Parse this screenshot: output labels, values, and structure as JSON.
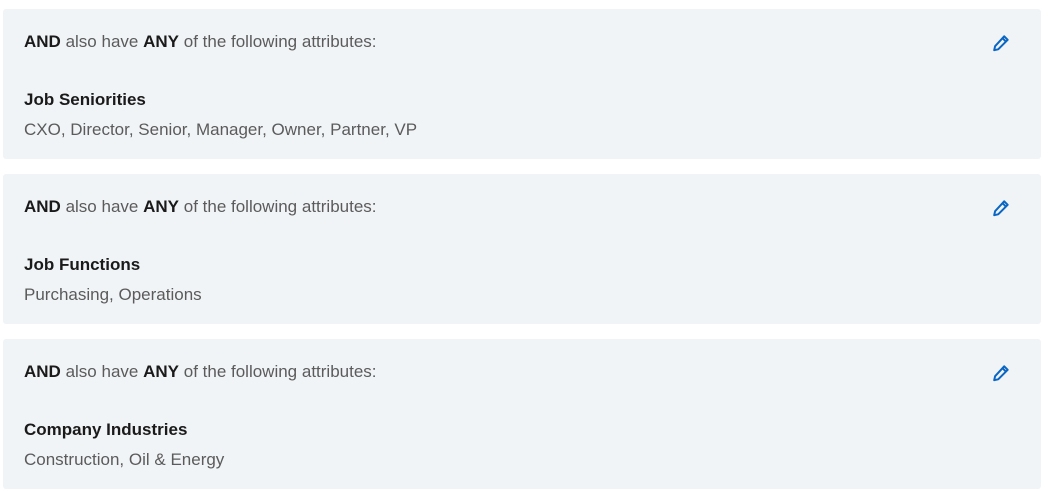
{
  "criteria": [
    {
      "and_word": "AND",
      "also_have": "also have",
      "any_word": "ANY",
      "following": "of the following attributes:",
      "attribute_name": "Job Seniorities",
      "attribute_values": "CXO, Director, Senior, Manager, Owner, Partner, VP",
      "edit_icon": "pencil-icon"
    },
    {
      "and_word": "AND",
      "also_have": "also have",
      "any_word": "ANY",
      "following": "of the following attributes:",
      "attribute_name": "Job Functions",
      "attribute_values": "Purchasing, Operations",
      "edit_icon": "pencil-icon"
    },
    {
      "and_word": "AND",
      "also_have": "also have",
      "any_word": "ANY",
      "following": "of the following attributes:",
      "attribute_name": "Company Industries",
      "attribute_values": "Construction, Oil & Energy",
      "edit_icon": "pencil-icon"
    }
  ],
  "colors": {
    "card_background": "#f1f4f7",
    "edit_icon": "#0a66c2",
    "muted_text": "#5b5b5b",
    "strong_text": "#1a1a1a"
  }
}
